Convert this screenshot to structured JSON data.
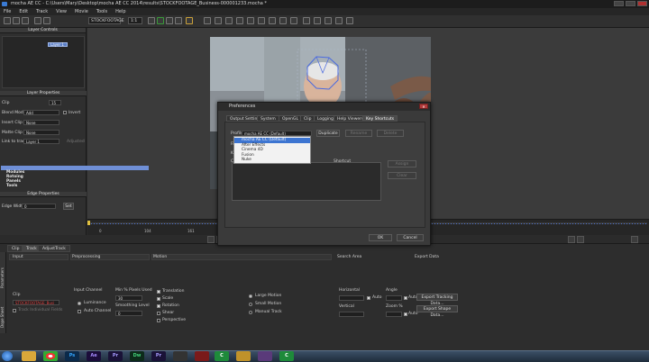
{
  "window": {
    "title": "mocha AE CC - C:\\Users\\Mary\\Desktop\\mocha AE CC 2014\\results\\STOCKFOOTAGE_Business-000001233.mocha *"
  },
  "menu": [
    "File",
    "Edit",
    "Track",
    "View",
    "Movie",
    "Tools",
    "Help"
  ],
  "toolbar": {
    "clip_selector": "STOCKFOOTAGE",
    "zoom": "1:1"
  },
  "left_panel": {
    "layer_controls_title": "Layer Controls",
    "layer_name": "Layer 1",
    "layer_properties_title": "Layer Properties",
    "clip_label": "Clip",
    "clip_field": "15",
    "blend_mode_label": "Blend Mode",
    "blend_mode_value": "Add",
    "invert_label": "Invert",
    "insert_clip_label": "Insert Clip",
    "insert_clip_value": "None",
    "matte_clip_label": "Matte Clip",
    "matte_clip_value": "None",
    "link_to_track_label": "Link to track",
    "link_to_track_value": "Layer 1",
    "adjusted_label": "Adjusted",
    "edge_properties_title": "Edge Properties",
    "edge_width_label": "Edge Width",
    "edge_width_value": "0",
    "set_label": "Set"
  },
  "timeline": {
    "ticks": [
      "0",
      "104",
      "161"
    ]
  },
  "bottom_tabs": [
    "Clip",
    "Track",
    "AdjustTrack"
  ],
  "vertical_tabs": [
    "Parameters",
    "Dope Sheet"
  ],
  "track_panel": {
    "input_title": "Input",
    "clip_label": "Clip",
    "clip_value": "STOCKFOOTAGE_Busi",
    "track_individual_fields": "Track Individual Fields",
    "preprocessing_title": "Preprocessing",
    "input_channel_label": "Input Channel",
    "luminance_label": "Luminance",
    "auto_channel_label": "Auto Channel",
    "min_pixels_label": "Min % Pixels Used",
    "min_pixels_value": "30",
    "smoothing_label": "Smoothing Level",
    "smoothing_value": "0",
    "motion_title": "Motion",
    "motion_options": [
      "Translation",
      "Scale",
      "Rotation",
      "Shear",
      "Perspective"
    ],
    "motion_size": [
      "Large Motion",
      "Small Motion",
      "Manual Track"
    ],
    "search_area_title": "Search Area",
    "horizontal_label": "Horizontal",
    "vertical_label": "Vertical",
    "auto_label": "Auto",
    "angle_label": "Angle",
    "zoom_label": "Zoom %",
    "export_title": "Export Data",
    "export_tracking_button": "Export Tracking Data...",
    "export_shape_button": "Export Shape Data..."
  },
  "dialog": {
    "title": "Preferences",
    "tabs": [
      "Output Settings",
      "System",
      "OpenGL",
      "Clip",
      "Logging",
      "Help Viewers",
      "Key Shortcuts"
    ],
    "active_tab": "Key Shortcuts",
    "profile_label": "Profile",
    "profile_value": "mocha AE CC (Default)",
    "duplicate_button": "Duplicate",
    "rename_button": "Rename",
    "delete_button": "Delete",
    "filter_label": "Filter",
    "key_label": "Key Sequence",
    "category_label": "Categ",
    "shortcut_header": "Shortcut",
    "dropdown_items": [
      "mocha AE CC (Default)",
      "After Effects",
      "Cinema 4D",
      "Fusion",
      "Nuke"
    ],
    "list_rows": [
      "Modules",
      "Rotoing",
      "Panels",
      "Tools"
    ],
    "assign_button": "Assign",
    "clear_button": "Clear",
    "ok_button": "OK",
    "cancel_button": "Cancel"
  },
  "taskbar": {
    "apps": [
      "explorer",
      "chrome",
      "photoshop",
      "after-effects",
      "premiere",
      "dreamweaver",
      "premiere-alt",
      "tool",
      "mocha",
      "mocha-alt",
      "media",
      "folder",
      "mocha-ae"
    ]
  }
}
